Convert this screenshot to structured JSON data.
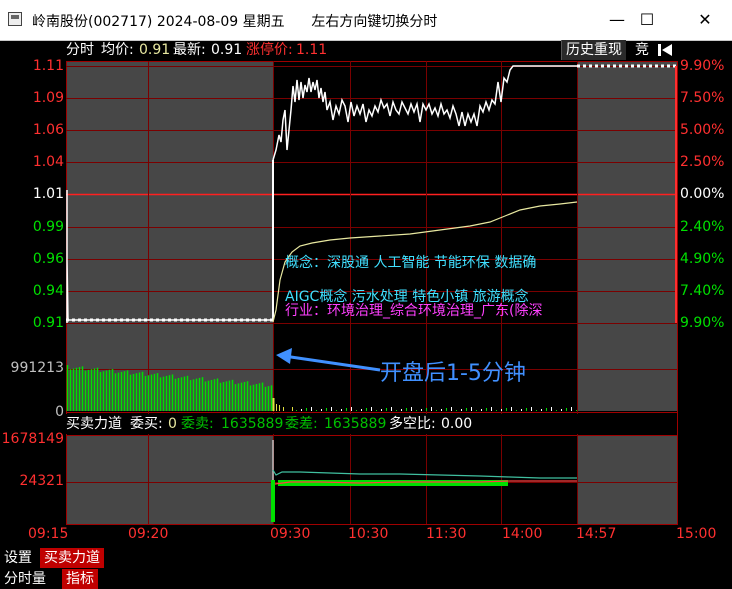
{
  "window": {
    "title": "岭南股份(002717) 2024-08-09 星期五      左右方向键切换分时",
    "minimize_label": "—",
    "maximize_label": "☐",
    "close_label": "✕"
  },
  "header": {
    "mode_label": "分时",
    "avg_label": "均价:",
    "avg_value": "0.91",
    "latest_label": "最新:",
    "latest_value": "0.91",
    "limitup_label": "涨停价:",
    "limitup_value": "1.11",
    "history_button": "历史重现",
    "auction_button": "竞",
    "back_icon": "back-to-start-icon"
  },
  "price_axis": {
    "left_ticks": [
      "1.11",
      "1.09",
      "1.06",
      "1.04",
      "1.01",
      "0.99",
      "0.96",
      "0.94",
      "0.91"
    ],
    "right_ticks": [
      "9.90%",
      "7.50%",
      "5.00%",
      "2.50%",
      "0.00%",
      "2.40%",
      "4.90%",
      "7.40%",
      "9.90%"
    ]
  },
  "volume_axis": {
    "left_ticks": [
      "991213",
      "0"
    ]
  },
  "concept_text": {
    "line1": "概念：深股通  人工智能  节能环保  数据确",
    "line2": "AIGC概念  污水处理  特色小镇  旅游概念",
    "line3": "行业：环境治理_综合环境治理_广东(除深",
    "annotation": "开盘后1-5分钟"
  },
  "force_panel": {
    "title_label": "买卖力道",
    "buy_label": "委买:",
    "buy_value": "0",
    "sell_label": "委卖:",
    "sell_value": "1635889",
    "diff_label": "委差:",
    "diff_value": "1635889",
    "ratio_label": "多空比:",
    "ratio_value": "0.00",
    "left_ticks": [
      "1678149",
      "24321"
    ]
  },
  "time_axis": {
    "labels": [
      "09:15",
      "09:20",
      "09:30",
      "10:30",
      "11:30",
      "14:00",
      "14:57",
      "15:00"
    ]
  },
  "bottom_tabs": {
    "row1": [
      "设置",
      "买卖力道"
    ],
    "row2": [
      "分时量",
      "指标"
    ]
  },
  "colors": {
    "limit_red": "#ff3030",
    "grid_red": "#800000",
    "price_white": "#ffffff",
    "avg_yellow": "#e8e8a0",
    "volume_green": "#00e000",
    "concept_cyan": "#40e0ff",
    "concept_magenta": "#ff40ff",
    "annotation_blue": "#4090ff",
    "panel_gray": "#4a4a4a"
  }
}
